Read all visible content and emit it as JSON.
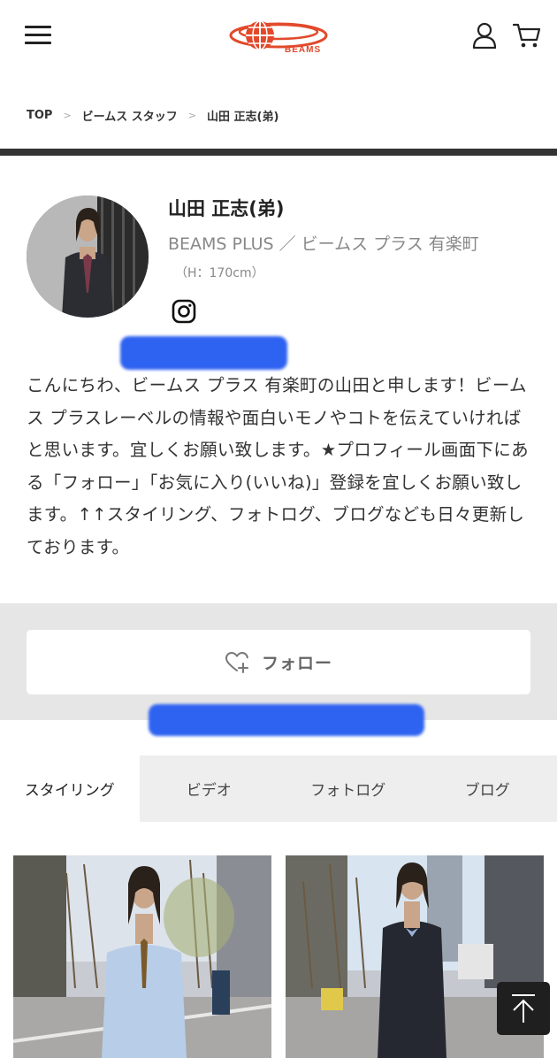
{
  "header": {
    "menu_icon": "hamburger-menu-icon",
    "logo_text": "BEAMS",
    "user_icon": "user-icon",
    "cart_icon": "cart-icon",
    "brand_color": "#e2492a"
  },
  "breadcrumb": {
    "items": [
      "TOP",
      "ビームス スタッフ",
      "山田 正志(弟)"
    ],
    "separator": ">"
  },
  "profile": {
    "name": "山田 正志(弟)",
    "shop": "BEAMS PLUS ／ ビームス プラス 有楽町",
    "height": "（H：170cm）",
    "social_icon": "instagram-icon",
    "bio": "こんにちわ、ビームス プラス 有楽町の山田と申します！ビームス プラスレーベルの情報や面白いモノやコトを伝えていければと思います。宜しくお願い致します。★プロフィール画面下にある「フォロー」「お気に入り(いいね)」登録を宜しくお願い致します。↑↑スタイリング、フォトログ、ブログなども日々更新しております。"
  },
  "follow": {
    "label": "フォロー",
    "icon": "heart-plus-icon"
  },
  "tabs": [
    {
      "label": "スタイリング",
      "active": true
    },
    {
      "label": "ビデオ",
      "active": false
    },
    {
      "label": "フォトログ",
      "active": false
    },
    {
      "label": "ブログ",
      "active": false
    }
  ],
  "scroll_top_icon": "arrow-up-icon",
  "redaction_color": "#2e62f0"
}
